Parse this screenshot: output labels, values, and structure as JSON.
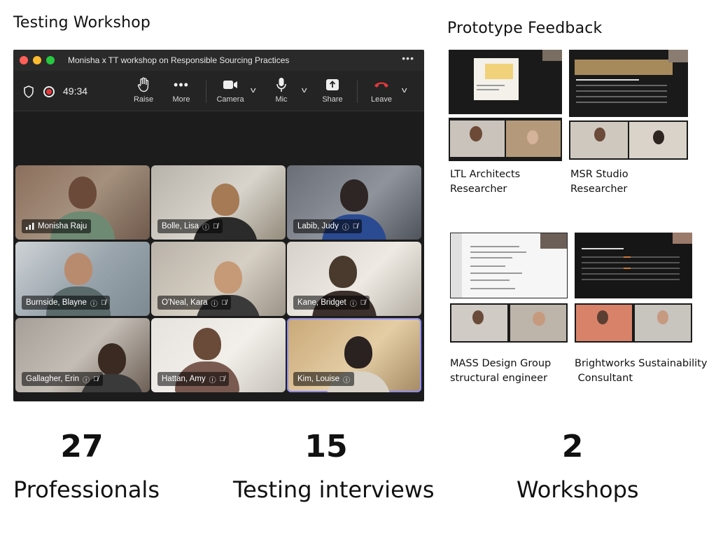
{
  "headings": {
    "testing_workshop": "Testing Workshop",
    "prototype_feedback": "Prototype Feedback"
  },
  "zoom": {
    "window_title": "Monisha x TT workshop on Responsible Sourcing Practices",
    "more_menu": "•••",
    "timer": "49:34",
    "toolbar": {
      "raise": "Raise",
      "more": "More",
      "camera": "Camera",
      "mic": "Mic",
      "share": "Share",
      "leave": "Leave"
    },
    "participants": [
      {
        "name": "Monisha Raju",
        "muted": false,
        "active": false
      },
      {
        "name": "Bolle, Lisa",
        "muted": true,
        "active": false
      },
      {
        "name": "Labib, Judy",
        "muted": true,
        "active": false
      },
      {
        "name": "Burnside, Blayne",
        "muted": true,
        "active": false
      },
      {
        "name": "O'Neal, Kara",
        "muted": true,
        "active": false
      },
      {
        "name": "Kane, Bridget",
        "muted": true,
        "active": false
      },
      {
        "name": "Gallagher, Erin",
        "muted": true,
        "active": false
      },
      {
        "name": "Hattan, Amy",
        "muted": true,
        "active": false
      },
      {
        "name": "Kim, Louise",
        "muted": false,
        "active": true
      }
    ]
  },
  "feedback": [
    {
      "line1": "LTL Architects",
      "line2": "Researcher"
    },
    {
      "line1": "MSR Studio",
      "line2": "Researcher"
    },
    {
      "line1": "MASS Design Group",
      "line2": "structural engineer"
    },
    {
      "line1": "Brightworks Sustainability",
      "line2": " Consultant"
    }
  ],
  "stats": [
    {
      "value": "27",
      "label": "Professionals"
    },
    {
      "value": "15",
      "label": "Testing interviews"
    },
    {
      "value": "2",
      "label": "Workshops"
    }
  ],
  "colors": {
    "active_speaker": "#8c8cf5",
    "leave": "#e5383b"
  }
}
